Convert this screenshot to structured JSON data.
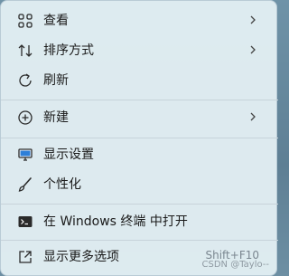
{
  "menu": {
    "items": [
      {
        "label": "查看",
        "icon": "grid-icon",
        "submenu": true
      },
      {
        "label": "排序方式",
        "icon": "sort-icon",
        "submenu": true
      },
      {
        "label": "刷新",
        "icon": "refresh-icon",
        "submenu": false
      },
      {
        "label": "新建",
        "icon": "add-circle-icon",
        "submenu": true
      },
      {
        "label": "显示设置",
        "icon": "display-icon",
        "submenu": false
      },
      {
        "label": "个性化",
        "icon": "brush-icon",
        "submenu": false
      },
      {
        "label": "在 Windows 终端 中打开",
        "icon": "terminal-icon",
        "submenu": false
      },
      {
        "label": "显示更多选项",
        "icon": "share-icon",
        "submenu": false,
        "shortcut": "Shift+F10"
      }
    ]
  },
  "watermark": "CSDN @Taylo--",
  "colors": {
    "menu_bg": "#e2eef3",
    "border": "#b9cbd6",
    "text": "#1a1a1a",
    "icon": "#2b2b2b"
  }
}
